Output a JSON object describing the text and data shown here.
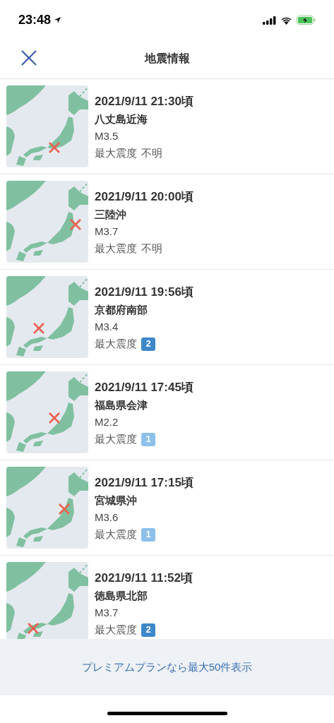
{
  "status_bar": {
    "time": "23:48"
  },
  "nav": {
    "title": "地震情報"
  },
  "quakes": [
    {
      "time": "2021/9/11 21:30頃",
      "place": "八丈島近海",
      "magnitude": "M3.5",
      "intensity_label": "最大震度",
      "intensity": {
        "kind": "text",
        "value": "不明"
      }
    },
    {
      "time": "2021/9/11 20:00頃",
      "place": "三陸沖",
      "magnitude": "M3.7",
      "intensity_label": "最大震度",
      "intensity": {
        "kind": "text",
        "value": "不明"
      }
    },
    {
      "time": "2021/9/11 19:56頃",
      "place": "京都府南部",
      "magnitude": "M3.4",
      "intensity_label": "最大震度",
      "intensity": {
        "kind": "badge",
        "value": "2",
        "color": "#3d88c9"
      }
    },
    {
      "time": "2021/9/11 17:45頃",
      "place": "福島県会津",
      "magnitude": "M2.2",
      "intensity_label": "最大震度",
      "intensity": {
        "kind": "badge",
        "value": "1",
        "color": "#8cc0ea"
      }
    },
    {
      "time": "2021/9/11 17:15頃",
      "place": "宮城県沖",
      "magnitude": "M3.6",
      "intensity_label": "最大震度",
      "intensity": {
        "kind": "badge",
        "value": "1",
        "color": "#8cc0ea"
      }
    },
    {
      "time": "2021/9/11 11:52頃",
      "place": "徳島県北部",
      "magnitude": "M3.7",
      "intensity_label": "最大震度",
      "intensity": {
        "kind": "badge",
        "value": "2",
        "color": "#3d88c9"
      }
    }
  ],
  "footer": {
    "link": "プレミアムプランなら最大50件表示"
  }
}
